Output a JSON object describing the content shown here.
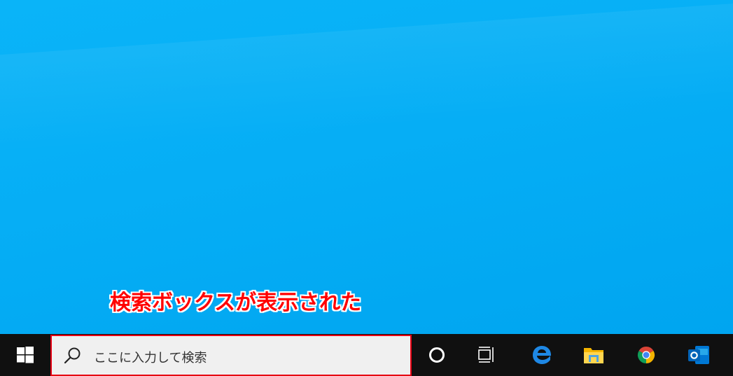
{
  "annotation": {
    "text": "検索ボックスが表示された",
    "color": "#ff0000"
  },
  "taskbar": {
    "background": "#101010",
    "search": {
      "placeholder": "ここに入力して検索",
      "icon": "search-icon",
      "highlight_color": "#e60012"
    },
    "icons": [
      {
        "name": "windows-start-icon"
      },
      {
        "name": "cortana-icon"
      },
      {
        "name": "task-view-icon"
      },
      {
        "name": "edge-icon"
      },
      {
        "name": "file-explorer-icon"
      },
      {
        "name": "chrome-icon"
      },
      {
        "name": "outlook-icon"
      }
    ]
  },
  "desktop": {
    "background": "#06aef5"
  }
}
